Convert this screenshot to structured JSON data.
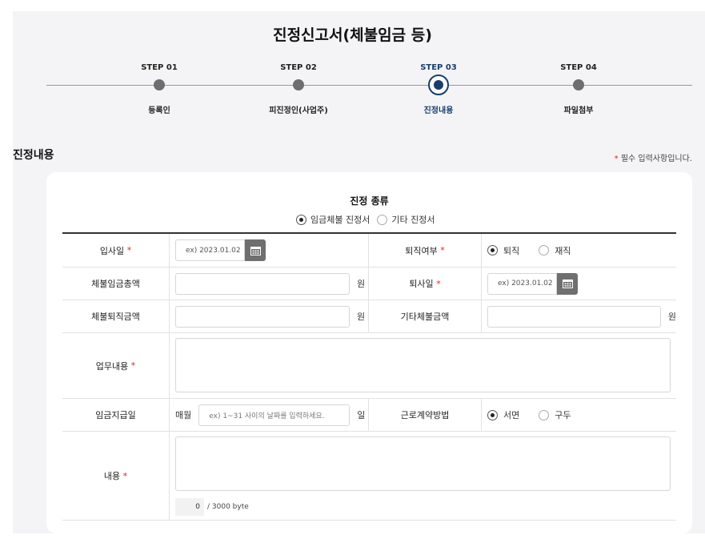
{
  "title": "진정신고서(체불임금 등)",
  "steps": [
    {
      "label": "STEP 01",
      "name": "등록인"
    },
    {
      "label": "STEP 02",
      "name": "피진정인(사업주)"
    },
    {
      "label": "STEP 03",
      "name": "진정내용"
    },
    {
      "label": "STEP 04",
      "name": "파일첨부"
    }
  ],
  "active_step": 3,
  "section_title": "진정내용",
  "required_note": "필수 입력사항입니다.",
  "required_mark": "*",
  "kind": {
    "title": "진정 종류",
    "options": [
      "임금체불 진정서",
      "기타 진정서"
    ],
    "selected": "임금체불 진정서"
  },
  "form": {
    "hire_date": {
      "label": "입사일",
      "placeholder": "ex) 2023.01.02"
    },
    "retired": {
      "label": "퇴직여부",
      "options": [
        "퇴직",
        "재직"
      ],
      "selected": "퇴직"
    },
    "unpaid_wage_total": {
      "label": "체불임금총액",
      "unit": "원",
      "value": ""
    },
    "retire_date": {
      "label": "퇴사일",
      "placeholder": "ex) 2023.01.02"
    },
    "unpaid_severance": {
      "label": "체불퇴직금액",
      "unit": "원",
      "value": ""
    },
    "other_unpaid": {
      "label": "기타체불금액",
      "unit": "원",
      "value": ""
    },
    "job_desc": {
      "label": "업무내용",
      "value": ""
    },
    "pay_day": {
      "label": "임금지급일",
      "prefix": "매월",
      "placeholder": "ex) 1~31 사이의 날짜를 입력하세요.",
      "unit": "일"
    },
    "contract_method": {
      "label": "근로계약방법",
      "options": [
        "서면",
        "구두"
      ],
      "selected": "서면"
    },
    "content": {
      "label": "내용",
      "value": "",
      "count": "0",
      "limit": "/ 3000 byte"
    }
  },
  "icons": {
    "calendar": "calendar-icon"
  },
  "colors": {
    "accent": "#183e6c",
    "required": "#e02020",
    "background": "#f4f4f6"
  }
}
